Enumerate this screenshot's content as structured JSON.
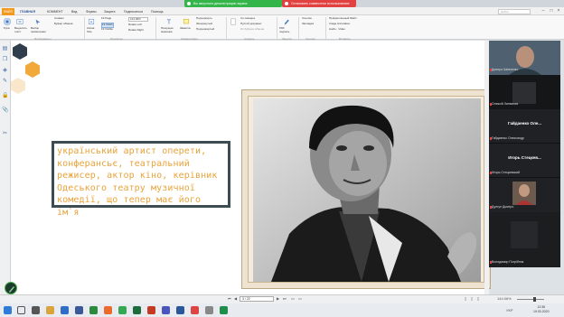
{
  "share_bar": {
    "green_label": "Вы запустили демонстрацию экрана",
    "red_label": "Остановить совместное использование"
  },
  "tabs": [
    "ФАЙЛ",
    "ГЛАВНАЯ",
    "КОММЕНТ",
    "Вид",
    "Формы",
    "Защита",
    "Подписаться",
    "Помощь"
  ],
  "search_placeholder": "Найти",
  "ribbon": {
    "hand": "Рука",
    "select_text": "Выделить текст",
    "choose_annotation": "Выбор примечания",
    "snapshot": "Снимок",
    "clipboard": "Буфер обмена",
    "actual_size": "Actual Size",
    "fit_page": "Fit Page",
    "fit_width": "Fit Width",
    "fit_visible": "Fit Visible",
    "zoom": "144.06%",
    "rotate_left": "Rotate Left",
    "rotate_right": "Rotate Right",
    "typewriter": "Пишущая машинка",
    "highlight": "Заметка",
    "underline": "Подчеркнуть",
    "strikethrough": "Зачеркнутый",
    "replace": "Подчеркнутый",
    "from_scanner": "Со сканера",
    "blank": "Пустой документ",
    "from_clipboard": "Из буфера обмена",
    "pdf_sign": "PDF подпись",
    "link": "Ссылка",
    "bookmark": "Закладка",
    "attach_file": "Прикрепленный Файл",
    "image_annotation": "Image Annotation",
    "audio_video": "Audio - Video",
    "groups": [
      "Инструменты",
      "Просмотр",
      "Комментарии",
      "Создать",
      "Защита",
      "Ссылки",
      "Вставить"
    ]
  },
  "slide_text": "український артист оперети, конферансьє, театральний режисер, актор кіно, керівник Одеського театру музичної комедії, що тепер має його ім`я",
  "participants": [
    {
      "name": "Дмитро Шевченко",
      "kind": "video"
    },
    {
      "name": "Олексій Литвинов",
      "kind": "video-dark"
    },
    {
      "name": "Гайдаенко Олександр",
      "kind": "text",
      "big": "Гайдаенко Оле..."
    },
    {
      "name": "Игорь Стецкевский",
      "kind": "text",
      "big": "Игорь Стецкев..."
    },
    {
      "name": "Дунгун Дмитро",
      "kind": "video-small"
    },
    {
      "name": "Володимир Погрібняк",
      "kind": "video-dark"
    }
  ],
  "status": {
    "page": "3 / 22",
    "zoom": "144.06%"
  },
  "taskbar": {
    "lang": "УКР",
    "time": "12:36",
    "date": "19.03.2020"
  },
  "colors": {
    "accent": "#2b5797",
    "file_tab": "#f29a1f",
    "slide_text": "#e8a33a",
    "textbox_border": "#3d4b52",
    "share_green": "#33b54a",
    "share_red": "#e24141"
  }
}
